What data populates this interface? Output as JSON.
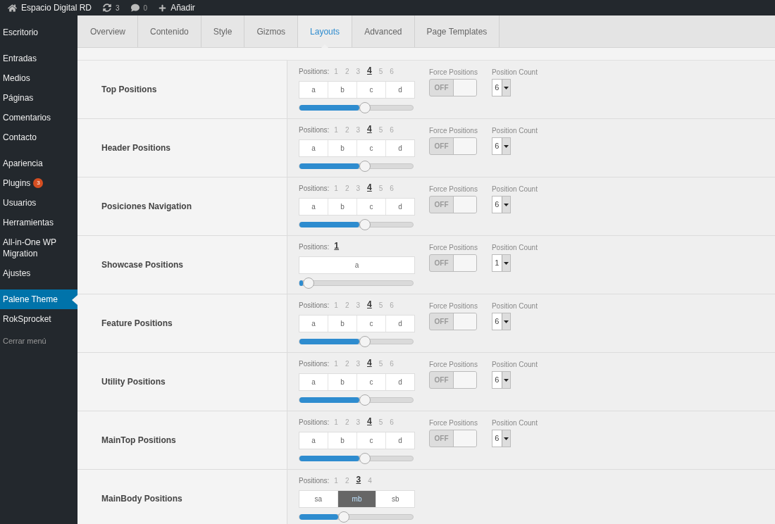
{
  "admin_bar": {
    "site_name": "Espacio Digital RD",
    "updates": "3",
    "comments": "0",
    "add_new": "Añadir"
  },
  "sidebar": {
    "groups": [
      [
        {
          "label": "Escritorio",
          "selected": false
        }
      ],
      [
        {
          "label": "Entradas",
          "selected": false
        },
        {
          "label": "Medios",
          "selected": false
        },
        {
          "label": "Páginas",
          "selected": false
        },
        {
          "label": "Comentarios",
          "selected": false
        },
        {
          "label": "Contacto",
          "selected": false
        }
      ],
      [
        {
          "label": "Apariencia",
          "selected": false
        },
        {
          "label": "Plugins",
          "selected": false,
          "badge": "3"
        },
        {
          "label": "Usuarios",
          "selected": false
        },
        {
          "label": "Herramientas",
          "selected": false
        },
        {
          "label": "All-in-One WP Migration",
          "selected": false
        },
        {
          "label": "Ajustes",
          "selected": false
        }
      ],
      [
        {
          "label": "Palene Theme",
          "selected": true
        },
        {
          "label": "RokSprocket",
          "selected": false
        }
      ]
    ],
    "collapse": "Cerrar menú"
  },
  "tabs": [
    {
      "label": "Overview",
      "selected": false
    },
    {
      "label": "Contenido",
      "selected": false
    },
    {
      "label": "Style",
      "selected": false
    },
    {
      "label": "Gizmos",
      "selected": false
    },
    {
      "label": "Layouts",
      "selected": true
    },
    {
      "label": "Advanced",
      "selected": false
    },
    {
      "label": "Page Templates",
      "selected": false
    }
  ],
  "rows": [
    {
      "title": "Top Positions",
      "positions_label": "Positions:",
      "positions": [
        {
          "label": "1",
          "selected": false
        },
        {
          "label": "2",
          "selected": false
        },
        {
          "label": "3",
          "selected": false
        },
        {
          "label": "4",
          "selected": true
        },
        {
          "label": "5",
          "selected": false
        },
        {
          "label": "6",
          "selected": false
        }
      ],
      "cells": [
        {
          "label": "a",
          "selected": false
        },
        {
          "label": "b",
          "selected": false
        },
        {
          "label": "c",
          "selected": false
        },
        {
          "label": "d",
          "selected": false
        }
      ],
      "level": 0.58,
      "force": {
        "label": "Force Positions",
        "state": "OFF",
        "on": false
      },
      "count": {
        "label": "Position Count",
        "value": "6"
      }
    },
    {
      "title": "Header Positions",
      "positions_label": "Positions:",
      "positions": [
        {
          "label": "1",
          "selected": false
        },
        {
          "label": "2",
          "selected": false
        },
        {
          "label": "3",
          "selected": false
        },
        {
          "label": "4",
          "selected": true
        },
        {
          "label": "5",
          "selected": false
        },
        {
          "label": "6",
          "selected": false
        }
      ],
      "cells": [
        {
          "label": "a",
          "selected": false
        },
        {
          "label": "b",
          "selected": false
        },
        {
          "label": "c",
          "selected": false
        },
        {
          "label": "d",
          "selected": false
        }
      ],
      "level": 0.58,
      "force": {
        "label": "Force Positions",
        "state": "OFF",
        "on": false
      },
      "count": {
        "label": "Position Count",
        "value": "6"
      }
    },
    {
      "title": "Posiciones Navigation",
      "positions_label": "Positions:",
      "positions": [
        {
          "label": "1",
          "selected": false
        },
        {
          "label": "2",
          "selected": false
        },
        {
          "label": "3",
          "selected": false
        },
        {
          "label": "4",
          "selected": true
        },
        {
          "label": "5",
          "selected": false
        },
        {
          "label": "6",
          "selected": false
        }
      ],
      "cells": [
        {
          "label": "a",
          "selected": false
        },
        {
          "label": "b",
          "selected": false
        },
        {
          "label": "c",
          "selected": false
        },
        {
          "label": "d",
          "selected": false
        }
      ],
      "level": 0.58,
      "force": {
        "label": "Force Positions",
        "state": "OFF",
        "on": false
      },
      "count": {
        "label": "Position Count",
        "value": "6"
      }
    },
    {
      "title": "Showcase Positions",
      "positions_label": "Positions:",
      "positions": [
        {
          "label": "1",
          "selected": true
        }
      ],
      "cells": [
        {
          "label": "a",
          "selected": false
        }
      ],
      "level": 0.08,
      "force": {
        "label": "Force Positions",
        "state": "OFF",
        "on": false
      },
      "count": {
        "label": "Position Count",
        "value": "1"
      }
    },
    {
      "title": "Feature Positions",
      "positions_label": "Positions:",
      "positions": [
        {
          "label": "1",
          "selected": false
        },
        {
          "label": "2",
          "selected": false
        },
        {
          "label": "3",
          "selected": false
        },
        {
          "label": "4",
          "selected": true
        },
        {
          "label": "5",
          "selected": false
        },
        {
          "label": "6",
          "selected": false
        }
      ],
      "cells": [
        {
          "label": "a",
          "selected": false
        },
        {
          "label": "b",
          "selected": false
        },
        {
          "label": "c",
          "selected": false
        },
        {
          "label": "d",
          "selected": false
        }
      ],
      "level": 0.58,
      "force": {
        "label": "Force Positions",
        "state": "OFF",
        "on": false
      },
      "count": {
        "label": "Position Count",
        "value": "6"
      }
    },
    {
      "title": "Utility Positions",
      "positions_label": "Positions:",
      "positions": [
        {
          "label": "1",
          "selected": false
        },
        {
          "label": "2",
          "selected": false
        },
        {
          "label": "3",
          "selected": false
        },
        {
          "label": "4",
          "selected": true
        },
        {
          "label": "5",
          "selected": false
        },
        {
          "label": "6",
          "selected": false
        }
      ],
      "cells": [
        {
          "label": "a",
          "selected": false
        },
        {
          "label": "b",
          "selected": false
        },
        {
          "label": "c",
          "selected": false
        },
        {
          "label": "d",
          "selected": false
        }
      ],
      "level": 0.58,
      "force": {
        "label": "Force Positions",
        "state": "OFF",
        "on": false
      },
      "count": {
        "label": "Position Count",
        "value": "6"
      }
    },
    {
      "title": "MainTop Positions",
      "positions_label": "Positions:",
      "positions": [
        {
          "label": "1",
          "selected": false
        },
        {
          "label": "2",
          "selected": false
        },
        {
          "label": "3",
          "selected": false
        },
        {
          "label": "4",
          "selected": true
        },
        {
          "label": "5",
          "selected": false
        },
        {
          "label": "6",
          "selected": false
        }
      ],
      "cells": [
        {
          "label": "a",
          "selected": false
        },
        {
          "label": "b",
          "selected": false
        },
        {
          "label": "c",
          "selected": false
        },
        {
          "label": "d",
          "selected": false
        }
      ],
      "level": 0.58,
      "force": {
        "label": "Force Positions",
        "state": "OFF",
        "on": false
      },
      "count": {
        "label": "Position Count",
        "value": "6"
      }
    },
    {
      "title": "MainBody Positions",
      "positions_label": "Positions:",
      "positions": [
        {
          "label": "1",
          "selected": false
        },
        {
          "label": "2",
          "selected": false
        },
        {
          "label": "3",
          "selected": true
        },
        {
          "label": "4",
          "selected": false
        }
      ],
      "cells": [
        {
          "label": "sa",
          "selected": false
        },
        {
          "label": "mb",
          "selected": true
        },
        {
          "label": "sb",
          "selected": false
        }
      ],
      "level": 0.39
    }
  ]
}
